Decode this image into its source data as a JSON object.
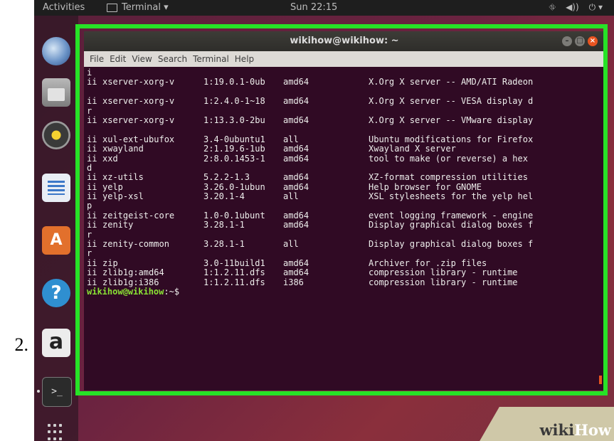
{
  "step_number": "2.",
  "top_bar": {
    "activities": "Activities",
    "app_menu": "Terminal ▾",
    "clock": "Sun 22:15",
    "tray": [
      "⛗",
      "◀))",
      "⏻ ▾"
    ]
  },
  "dock": {
    "icons": [
      "thunderbird-icon",
      "files-icon",
      "rhythmbox-icon",
      "writer-icon",
      "software-icon",
      "help-icon",
      "amazon-icon",
      "terminal-icon",
      "app-grid-icon"
    ],
    "software_glyph": "A",
    "help_glyph": "?",
    "amazon_glyph": "a",
    "terminal_glyph": ">_"
  },
  "terminal": {
    "title": "wikihow@wikihow: ~",
    "window_buttons": [
      "–",
      "□",
      "×"
    ],
    "menu": [
      "File",
      "Edit",
      "View",
      "Search",
      "Terminal",
      "Help"
    ],
    "lines": [
      {
        "cont": "i"
      },
      {
        "status": "ii",
        "name": "xserver-xorg-v",
        "version": "1:19.0.1-0ub",
        "arch": "amd64",
        "desc": "X.Org X server -- AMD/ATI Radeon"
      },
      {
        "cont": ""
      },
      {
        "status": "ii",
        "name": "xserver-xorg-v",
        "version": "1:2.4.0-1~18",
        "arch": "amd64",
        "desc": "X.Org X server -- VESA display d"
      },
      {
        "cont": "r"
      },
      {
        "status": "ii",
        "name": "xserver-xorg-v",
        "version": "1:13.3.0-2bu",
        "arch": "amd64",
        "desc": "X.Org X server -- VMware display"
      },
      {
        "cont": ""
      },
      {
        "status": "ii",
        "name": "xul-ext-ubufox",
        "version": "3.4-0ubuntu1",
        "arch": "all",
        "desc": "Ubuntu modifications for Firefox"
      },
      {
        "status": "ii",
        "name": "xwayland",
        "version": "2:1.19.6-1ub",
        "arch": "amd64",
        "desc": "Xwayland X server"
      },
      {
        "status": "ii",
        "name": "xxd",
        "version": "2:8.0.1453-1",
        "arch": "amd64",
        "desc": "tool to make (or reverse) a hex"
      },
      {
        "cont": "d"
      },
      {
        "status": "ii",
        "name": "xz-utils",
        "version": "5.2.2-1.3",
        "arch": "amd64",
        "desc": "XZ-format compression utilities"
      },
      {
        "status": "ii",
        "name": "yelp",
        "version": "3.26.0-1ubun",
        "arch": "amd64",
        "desc": "Help browser for GNOME"
      },
      {
        "status": "ii",
        "name": "yelp-xsl",
        "version": "3.20.1-4",
        "arch": "all",
        "desc": "XSL stylesheets for the yelp hel"
      },
      {
        "cont": "p"
      },
      {
        "status": "ii",
        "name": "zeitgeist-core",
        "version": "1.0-0.1ubunt",
        "arch": "amd64",
        "desc": "event logging framework - engine"
      },
      {
        "status": "ii",
        "name": "zenity",
        "version": "3.28.1-1",
        "arch": "amd64",
        "desc": "Display graphical dialog boxes f"
      },
      {
        "cont": "r"
      },
      {
        "status": "ii",
        "name": "zenity-common",
        "version": "3.28.1-1",
        "arch": "all",
        "desc": "Display graphical dialog boxes f"
      },
      {
        "cont": "r"
      },
      {
        "status": "ii",
        "name": "zip",
        "version": "3.0-11build1",
        "arch": "amd64",
        "desc": "Archiver for .zip files"
      },
      {
        "status": "ii",
        "name": "zlib1g:amd64",
        "version": "1:1.2.11.dfs",
        "arch": "amd64",
        "desc": "compression library - runtime"
      },
      {
        "status": "ii",
        "name": "zlib1g:i386",
        "version": "1:1.2.11.dfs",
        "arch": "i386",
        "desc": "compression library - runtime"
      }
    ],
    "prompt_user": "wikihow@wikihow",
    "prompt_suffix": ":~$"
  },
  "watermark": {
    "wiki": "wiki",
    "how": "How"
  },
  "colors": {
    "highlight": "#27e227",
    "terminal_bg": "#300a24",
    "prompt": "#8ae234",
    "close_button": "#e95420"
  }
}
